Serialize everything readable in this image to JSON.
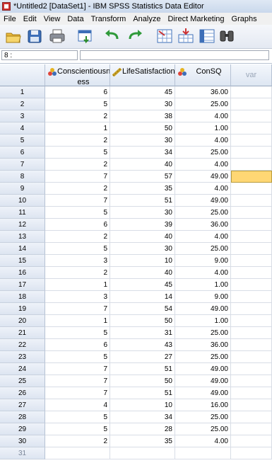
{
  "window": {
    "title": "*Untitled2 [DataSet1] - IBM SPSS Statistics Data Editor"
  },
  "menu": [
    "File",
    "Edit",
    "View",
    "Data",
    "Transform",
    "Analyze",
    "Direct Marketing",
    "Graphs"
  ],
  "toolbar_icons": [
    "open-folder-icon",
    "save-icon",
    "print-icon",
    "recall-dialog-icon",
    "undo-icon",
    "redo-icon",
    "goto-case-icon",
    "goto-variable-icon",
    "variables-icon",
    "find-icon"
  ],
  "cell_reference": {
    "label": "8 :",
    "value": ""
  },
  "columns": [
    {
      "name": "Conscientiousness",
      "header_line1": "Conscientiousn",
      "header_line2": "ess",
      "type": "nominal"
    },
    {
      "name": "LifeSatisfaction",
      "header_line1": "LifeSatisfaction",
      "header_line2": "",
      "type": "scale"
    },
    {
      "name": "ConSQ",
      "header_line1": "ConSQ",
      "header_line2": "",
      "type": "nominal"
    },
    {
      "name": "var",
      "header_line1": "var",
      "header_line2": "",
      "type": "empty"
    }
  ],
  "rows": [
    {
      "n": "1",
      "c": "6",
      "l": "45",
      "s": "36.00"
    },
    {
      "n": "2",
      "c": "5",
      "l": "30",
      "s": "25.00"
    },
    {
      "n": "3",
      "c": "2",
      "l": "38",
      "s": "4.00"
    },
    {
      "n": "4",
      "c": "1",
      "l": "50",
      "s": "1.00"
    },
    {
      "n": "5",
      "c": "2",
      "l": "30",
      "s": "4.00"
    },
    {
      "n": "6",
      "c": "5",
      "l": "34",
      "s": "25.00"
    },
    {
      "n": "7",
      "c": "2",
      "l": "40",
      "s": "4.00"
    },
    {
      "n": "8",
      "c": "7",
      "l": "57",
      "s": "49.00"
    },
    {
      "n": "9",
      "c": "2",
      "l": "35",
      "s": "4.00"
    },
    {
      "n": "10",
      "c": "7",
      "l": "51",
      "s": "49.00"
    },
    {
      "n": "11",
      "c": "5",
      "l": "30",
      "s": "25.00"
    },
    {
      "n": "12",
      "c": "6",
      "l": "39",
      "s": "36.00"
    },
    {
      "n": "13",
      "c": "2",
      "l": "40",
      "s": "4.00"
    },
    {
      "n": "14",
      "c": "5",
      "l": "30",
      "s": "25.00"
    },
    {
      "n": "15",
      "c": "3",
      "l": "10",
      "s": "9.00"
    },
    {
      "n": "16",
      "c": "2",
      "l": "40",
      "s": "4.00"
    },
    {
      "n": "17",
      "c": "1",
      "l": "45",
      "s": "1.00"
    },
    {
      "n": "18",
      "c": "3",
      "l": "14",
      "s": "9.00"
    },
    {
      "n": "19",
      "c": "7",
      "l": "54",
      "s": "49.00"
    },
    {
      "n": "20",
      "c": "1",
      "l": "50",
      "s": "1.00"
    },
    {
      "n": "21",
      "c": "5",
      "l": "31",
      "s": "25.00"
    },
    {
      "n": "22",
      "c": "6",
      "l": "43",
      "s": "36.00"
    },
    {
      "n": "23",
      "c": "5",
      "l": "27",
      "s": "25.00"
    },
    {
      "n": "24",
      "c": "7",
      "l": "51",
      "s": "49.00"
    },
    {
      "n": "25",
      "c": "7",
      "l": "50",
      "s": "49.00"
    },
    {
      "n": "26",
      "c": "7",
      "l": "51",
      "s": "49.00"
    },
    {
      "n": "27",
      "c": "4",
      "l": "10",
      "s": "16.00"
    },
    {
      "n": "28",
      "c": "5",
      "l": "34",
      "s": "25.00"
    },
    {
      "n": "29",
      "c": "5",
      "l": "28",
      "s": "25.00"
    },
    {
      "n": "30",
      "c": "2",
      "l": "35",
      "s": "4.00"
    },
    {
      "n": "31",
      "c": "",
      "l": "",
      "s": ""
    }
  ],
  "selected_row": "8",
  "colors": {
    "selection": "#ffd774",
    "header_bg": "#dde6f2"
  }
}
